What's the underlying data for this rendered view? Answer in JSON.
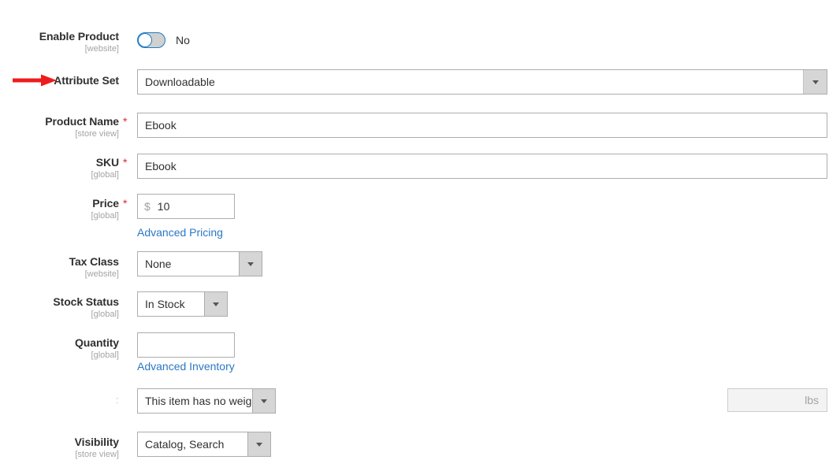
{
  "form": {
    "rows": [
      {
        "key": "enable_product",
        "label": "Enable Product",
        "scope": "[website]",
        "required": false,
        "control": "toggle",
        "value": "No"
      },
      {
        "key": "attribute_set",
        "label": "Attribute Set",
        "scope": "",
        "required": false,
        "control": "select",
        "value": "Downloadable"
      },
      {
        "key": "product_name",
        "label": "Product Name",
        "scope": "[store view]",
        "required": true,
        "control": "text",
        "value": "Ebook"
      },
      {
        "key": "sku",
        "label": "SKU",
        "scope": "[global]",
        "required": true,
        "control": "text",
        "value": "Ebook"
      },
      {
        "key": "price",
        "label": "Price",
        "scope": "[global]",
        "required": true,
        "control": "price",
        "currency": "$",
        "value": "10",
        "link": "Advanced Pricing"
      },
      {
        "key": "tax_class",
        "label": "Tax Class",
        "scope": "[website]",
        "required": false,
        "control": "select",
        "value": "None"
      },
      {
        "key": "stock_status",
        "label": "Stock Status",
        "scope": "[global]",
        "required": false,
        "control": "select",
        "value": "In Stock"
      },
      {
        "key": "quantity",
        "label": "Quantity",
        "scope": "[global]",
        "required": false,
        "control": "text",
        "value": "",
        "link": "Advanced Inventory"
      },
      {
        "key": "weight",
        "label": "",
        "scope": "",
        "required": false,
        "control": "select",
        "value": "This item has no weight",
        "unit": "lbs",
        "unit_value": ""
      },
      {
        "key": "visibility",
        "label": "Visibility",
        "scope": "[store view]",
        "required": false,
        "control": "select",
        "value": "Catalog, Search"
      }
    ]
  },
  "annotation": {
    "arrow_target": "Attribute Set",
    "arrow_color": "#ee1c1c"
  },
  "colors": {
    "link": "#2a78c4",
    "required_star": "#e22626",
    "toggle_accent": "#1d7cc4",
    "label": "#303030",
    "scope": "#a4a4a4",
    "border": "#adadad",
    "select_button": "#d6d6d6"
  },
  "misc": {
    "weight_row_marker": ":"
  }
}
